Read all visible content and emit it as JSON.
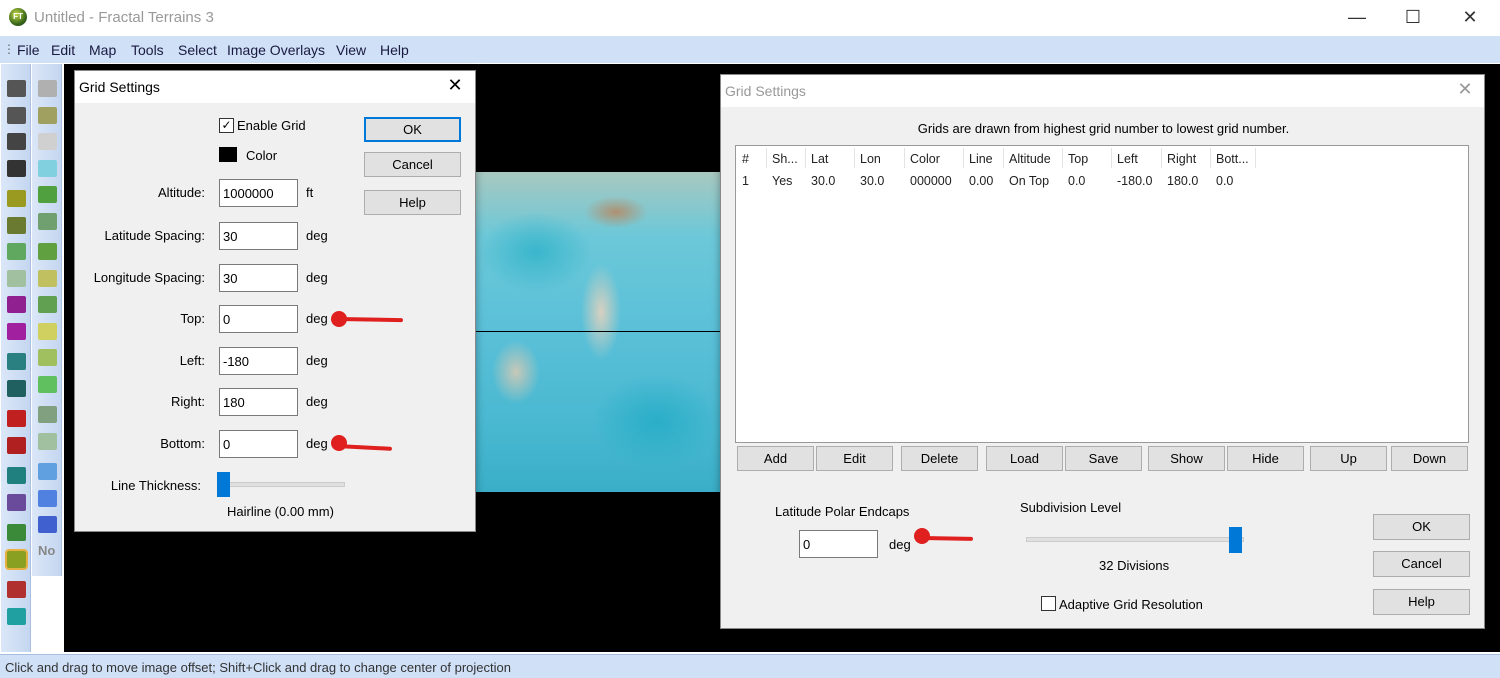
{
  "window": {
    "title": "Untitled - Fractal Terrains 3",
    "minimize": "—",
    "maximize": "☐",
    "close": "✕"
  },
  "menu": [
    "File",
    "Edit",
    "Map",
    "Tools",
    "Select",
    "Image Overlays",
    "View",
    "Help"
  ],
  "toolbar_left": [
    {
      "name": "select-rectangle-icon",
      "color": "#555"
    },
    {
      "name": "select-ellipse-icon",
      "color": "#555"
    },
    {
      "name": "select-lasso-icon",
      "color": "#444"
    },
    {
      "name": "select-polygon-icon",
      "color": "#333"
    },
    {
      "name": "terrain-raise-icon",
      "color": "#9a9a20"
    },
    {
      "name": "terrain-flatten-icon",
      "color": "#6a7a30"
    },
    {
      "name": "terrain-green-icon",
      "color": "#60a860"
    },
    {
      "name": "terrain-light-icon",
      "color": "#a0c0a0"
    },
    {
      "name": "terrain-purple-icon",
      "color": "#902090"
    },
    {
      "name": "terrain-purple-flat-icon",
      "color": "#a020a0"
    },
    {
      "name": "water-fill-icon",
      "color": "#2a8080"
    },
    {
      "name": "water-drain-icon",
      "color": "#206060"
    },
    {
      "name": "temperature-up-icon",
      "color": "#c02020"
    },
    {
      "name": "temperature-down-icon",
      "color": "#b02020"
    },
    {
      "name": "sea-level-icon",
      "color": "#208080"
    },
    {
      "name": "grid-overlay-icon",
      "color": "#6a4a9a"
    },
    {
      "name": "globe-icon",
      "color": "#3a8a3a"
    },
    {
      "name": "altitude-globe-icon",
      "color": "#8aa020"
    },
    {
      "name": "temperature-globe-icon",
      "color": "#b03030"
    },
    {
      "name": "water-globe-icon",
      "color": "#20a0a0"
    }
  ],
  "toolbar_right": [
    {
      "name": "mountains-icon",
      "color": "#b0b0b0"
    },
    {
      "name": "hills-icon",
      "color": "#a0a060"
    },
    {
      "name": "clouds-icon",
      "color": "#d0d0d0"
    },
    {
      "name": "water-waves-icon",
      "color": "#80d0e0"
    },
    {
      "name": "forest-icon",
      "color": "#50a040"
    },
    {
      "name": "conifer-forest-icon",
      "color": "#70a070"
    },
    {
      "name": "jungle-icon",
      "color": "#60a040"
    },
    {
      "name": "grassland-icon",
      "color": "#c0c060"
    },
    {
      "name": "trees-icon",
      "color": "#60a050"
    },
    {
      "name": "plains-icon",
      "color": "#d0d060"
    },
    {
      "name": "scrub-icon",
      "color": "#a0c060"
    },
    {
      "name": "meadow-icon",
      "color": "#60c060"
    },
    {
      "name": "marsh-icon",
      "color": "#80a080"
    },
    {
      "name": "swamp-icon",
      "color": "#a0c0a0"
    },
    {
      "name": "shallow-water-icon",
      "color": "#60a0e0"
    },
    {
      "name": "water-icon",
      "color": "#5080e0"
    },
    {
      "name": "deep-water-icon",
      "color": "#4060d0"
    },
    {
      "name": "no-icon",
      "color": "#888"
    }
  ],
  "toolbar_no_label": "No",
  "status": "Click and drag to move image offset; Shift+Click and drag to change center of projection",
  "dialog_left": {
    "title": "Grid Settings",
    "close": "✕",
    "enable_grid": {
      "label": "Enable Grid",
      "checked": true,
      "mark": "✓"
    },
    "color_label": "Color",
    "color": "#000000",
    "fields": [
      {
        "label": "Altitude:",
        "value": "1000000",
        "unit": "ft"
      },
      {
        "label": "Latitude Spacing:",
        "value": "30",
        "unit": "deg"
      },
      {
        "label": "Longitude Spacing:",
        "value": "30",
        "unit": "deg"
      },
      {
        "label": "Top:",
        "value": "0",
        "unit": "deg"
      },
      {
        "label": "Left:",
        "value": "-180",
        "unit": "deg"
      },
      {
        "label": "Right:",
        "value": "180",
        "unit": "deg"
      },
      {
        "label": "Bottom:",
        "value": "0",
        "unit": "deg"
      }
    ],
    "line_thickness_label": "Line Thickness:",
    "line_thickness_fraction": 0,
    "line_thickness_value": "Hairline (0.00 mm)",
    "ok": "OK",
    "cancel": "Cancel",
    "help": "Help"
  },
  "dialog_right": {
    "title": "Grid Settings",
    "close": "✕",
    "info": "Grids are drawn from highest grid number to lowest grid number.",
    "columns": [
      "#",
      "Sh...",
      "Lat",
      "Lon",
      "Color",
      "Line",
      "Altitude",
      "Top",
      "Left",
      "Right",
      "Bott..."
    ],
    "rows": [
      [
        "1",
        "Yes",
        "30.0",
        "30.0",
        "000000",
        "0.00",
        "On Top",
        "0.0",
        "-180.0",
        "180.0",
        "0.0"
      ]
    ],
    "buttons": [
      "Add",
      "Edit",
      "Delete",
      "Load",
      "Save",
      "Show",
      "Hide",
      "Up",
      "Down"
    ],
    "endcaps_label": "Latitude Polar Endcaps",
    "endcaps_value": "0",
    "endcaps_unit": "deg",
    "subdivision_label": "Subdivision Level",
    "subdivision_fraction": 1.0,
    "subdivision_value": "32 Divisions",
    "adaptive": {
      "label": "Adaptive Grid Resolution",
      "checked": false
    },
    "ok": "OK",
    "cancel": "Cancel",
    "help": "Help"
  },
  "colors": {
    "accent": "#0078d7",
    "annotation_arrow": "#e0201e",
    "menubar": "#cfe0f7"
  }
}
